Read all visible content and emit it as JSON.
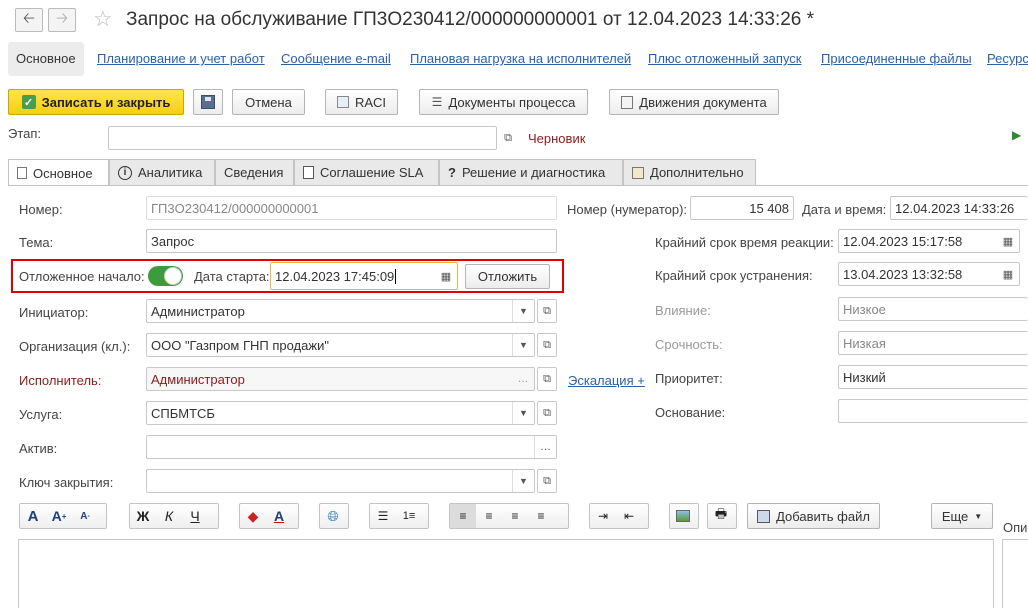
{
  "header": {
    "title": "Запрос на обслуживание ГП3О230412/000000000001 от 12.04.2023 14:33:26 *",
    "back_icon": "arrow-left-icon",
    "forward_icon": "arrow-right-icon",
    "favorite_icon": "star-icon"
  },
  "section_tabs": [
    "Основное",
    "Планирование и учет работ",
    "Сообщение e-mail",
    "Плановая нагрузка на исполнителей",
    "Плюс отложенный запуск",
    "Присоединенные файлы",
    "Ресурс"
  ],
  "toolbar": {
    "save_close": "Записать и закрыть",
    "cancel": "Отмена",
    "raci": "RACI",
    "process_docs": "Документы процесса",
    "doc_movements": "Движения документа"
  },
  "stage": {
    "label": "Этап:",
    "value": "",
    "status": "Черновик"
  },
  "tabs": [
    "Основное",
    "Аналитика",
    "Сведения",
    "Соглашение SLA",
    "Решение и диагностика",
    "Дополнительно"
  ],
  "form": {
    "number_label": "Номер:",
    "number_value": "ГП3О230412/000000000001",
    "numerator_label": "Номер (нумератор):",
    "numerator_value": "15 408",
    "datetime_label": "Дата и время:",
    "datetime_value": "12.04.2023 14:33:26",
    "subject_label": "Тема:",
    "subject_value": "Запрос",
    "reaction_label": "Крайний срок время реакции:",
    "reaction_value": "12.04.2023 15:17:58",
    "deferred_label": "Отложенное начало:",
    "deferred_on": true,
    "start_date_label": "Дата старта:",
    "start_date_value": "12.04.2023 17:45:09",
    "defer_button": "Отложить",
    "resolve_label": "Крайний срок устранения:",
    "resolve_value": "13.04.2023 13:32:58",
    "initiator_label": "Инициатор:",
    "initiator_value": "Администратор",
    "influence_label": "Влияние:",
    "influence_value": "Низкое",
    "org_label": "Организация (кл.):",
    "org_value": "ООО \"Газпром ГНП продажи\"",
    "urgency_label": "Срочность:",
    "urgency_value": "Низкая",
    "executor_label": "Исполнитель:",
    "executor_value": "Администратор",
    "escalation_link": "Эскалация +",
    "priority_label": "Приоритет:",
    "priority_value": "Низкий",
    "service_label": "Услуга:",
    "service_value": "СПБМТСБ",
    "basis_label": "Основание:",
    "basis_value": "",
    "asset_label": "Актив:",
    "asset_value": "",
    "close_key_label": "Ключ закрытия:",
    "close_key_value": ""
  },
  "editor_toolbar": {
    "bold": "Ж",
    "italic": "К",
    "underline": "Ч",
    "add_file": "Добавить файл",
    "more": "Еще",
    "side_label": "Опис"
  },
  "colors": {
    "accent_yellow": "#f5cf10",
    "highlight_red": "#e00000",
    "link": "#2b5fa8",
    "toggle_green": "#3d9a3d"
  }
}
